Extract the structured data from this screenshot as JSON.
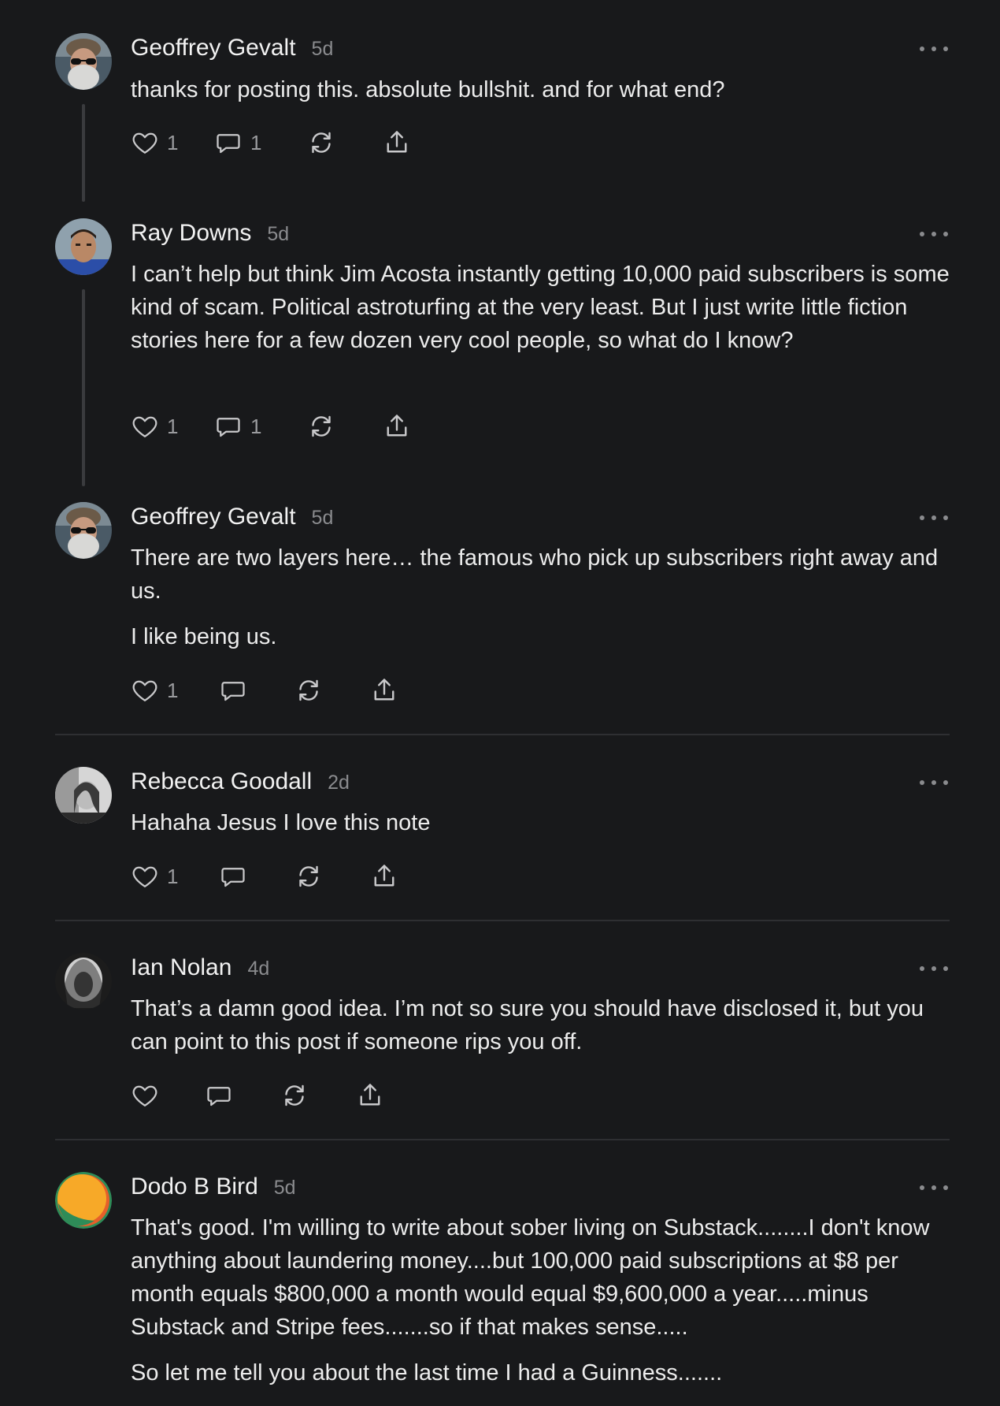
{
  "comments": [
    {
      "author": "Geoffrey Gevalt",
      "time": "5d",
      "paragraphs": [
        "thanks for posting this. absolute bullshit. and for what end?"
      ],
      "likes": "1",
      "replies": "1"
    },
    {
      "author": "Ray Downs",
      "time": "5d",
      "paragraphs": [
        "I can’t help but think Jim Acosta instantly getting 10,000 paid subscribers is some kind of scam. Political astroturfing at the very least. But I just write little fiction stories here for a few dozen very cool people, so what do I know?"
      ],
      "likes": "1",
      "replies": "1"
    },
    {
      "author": "Geoffrey Gevalt",
      "time": "5d",
      "paragraphs": [
        "There are two layers here… the famous who pick up subscribers right away and us.",
        "I like being us."
      ],
      "likes": "1",
      "replies": ""
    },
    {
      "author": "Rebecca Goodall",
      "time": "2d",
      "paragraphs": [
        "Hahaha Jesus I love this note"
      ],
      "likes": "1",
      "replies": ""
    },
    {
      "author": "Ian Nolan",
      "time": "4d",
      "paragraphs": [
        "That’s a damn good idea. I’m not so sure you should have disclosed it, but you can point to this post if someone rips you off."
      ],
      "likes": "",
      "replies": ""
    },
    {
      "author": "Dodo B Bird",
      "time": "5d",
      "paragraphs": [
        "That's good. I'm willing to write about sober living on Substack........I don't know anything about laundering money....but 100,000 paid subscriptions at $8 per month equals $800,000 a month would equal $9,600,000 a year.....minus Substack and Stripe fees.......so if that makes sense.....",
        "So let me tell you about the last time I had a Guinness......."
      ]
    }
  ],
  "icons": {
    "like": "heart-icon",
    "reply": "speech-bubble-icon",
    "restack": "restack-arrows-icon",
    "share": "share-upload-icon",
    "more": "ellipsis-icon"
  },
  "colors": {
    "background": "#18191b",
    "text": "#ececec",
    "muted": "#8a8b8e",
    "divider": "#2e2f32"
  }
}
